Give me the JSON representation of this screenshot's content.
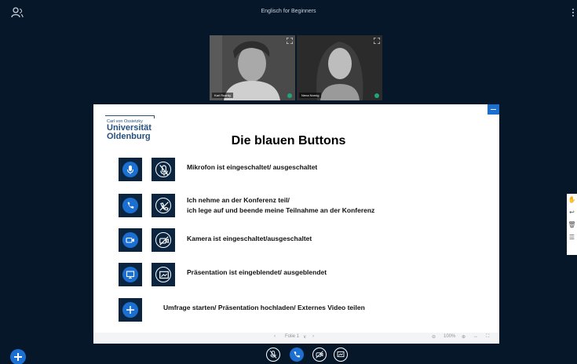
{
  "header": {
    "meeting_title": "Englisch for Beginners"
  },
  "videos": [
    {
      "name": "Karl Rusnig"
    },
    {
      "name": "Nena Nornig"
    }
  ],
  "slide": {
    "logo": {
      "line1": "Carl von Ossietzky",
      "line2": "Universität",
      "line3": "Oldenburg"
    },
    "title": "Die blauen Buttons",
    "rows": [
      {
        "icon_on": "microphone-icon",
        "icon_off": "microphone-muted-icon",
        "text": "Mikrofon ist eingeschaltet/ ausgeschaltet"
      },
      {
        "icon_on": "phone-icon",
        "icon_off": "phone-hangup-icon",
        "text": "Ich nehme an der Konferenz teil/",
        "text2": "ich lege auf und beende meine Teilnahme an der Konferenz"
      },
      {
        "icon_on": "camera-icon",
        "icon_off": "camera-off-icon",
        "text": "Kamera ist eingeschaltet/ausgeschaltet"
      },
      {
        "icon_on": "presentation-icon",
        "icon_off": "presentation-hidden-icon",
        "text": "Präsentation ist eingeblendet/  ausgeblendet"
      },
      {
        "icon_on": "plus-icon",
        "text": "Umfrage starten/ Präsentation hochladen/ Externes Video teilen"
      }
    ],
    "nav": {
      "slide_label": "Folie 1",
      "zoom": "100%"
    }
  },
  "bottom_controls": [
    "microphone-muted-icon",
    "phone-icon",
    "camera-off-icon",
    "presentation-hidden-icon"
  ],
  "colors": {
    "background": "#06172a",
    "accent": "#1b6fd1",
    "button_box": "#0b2540"
  }
}
